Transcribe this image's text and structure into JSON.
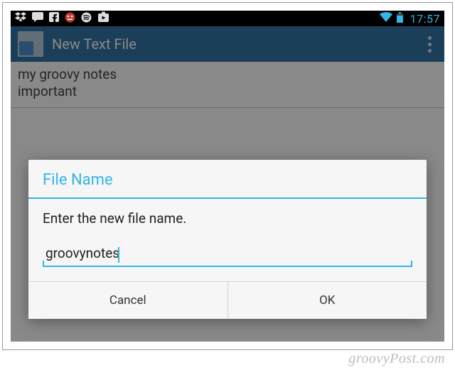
{
  "statusbar": {
    "clock": "17:57"
  },
  "actionbar": {
    "title": "New Text File"
  },
  "note": {
    "text": "my groovy notes\nimportant"
  },
  "dialog": {
    "title": "File Name",
    "message": "Enter the new file name.",
    "input_value": "groovynotes",
    "cancel_label": "Cancel",
    "ok_label": "OK"
  },
  "watermark": "groovyPost.com"
}
